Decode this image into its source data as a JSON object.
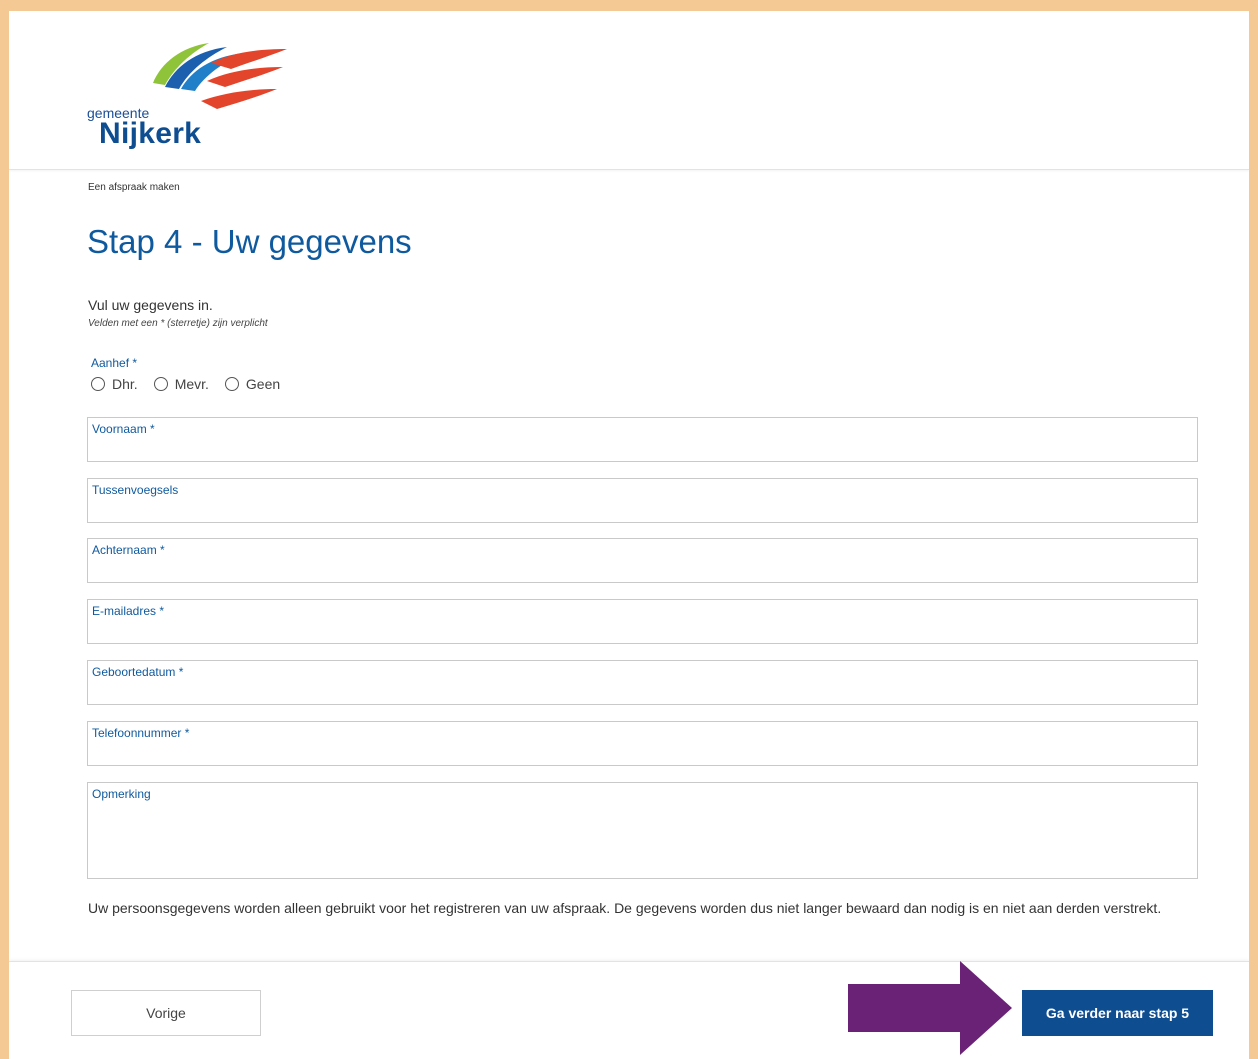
{
  "brand": {
    "small": "gemeente",
    "name": "Nijkerk",
    "colors": {
      "green": "#8fc43a",
      "blue": "#0f4d91",
      "red": "#e2452b",
      "accent_arrow": "#6a2277"
    }
  },
  "breadcrumb": "Een afspraak maken",
  "page_title": "Stap 4 - Uw gegevens",
  "intro": "Vul uw gegevens in.",
  "intro_note": "Velden met een * (sterretje) zijn verplicht",
  "salutation": {
    "label": "Aanhef *",
    "options": [
      "Dhr.",
      "Mevr.",
      "Geen"
    ]
  },
  "fields": {
    "first_name": {
      "label": "Voornaam *",
      "value": ""
    },
    "infix": {
      "label": "Tussenvoegsels",
      "value": ""
    },
    "last_name": {
      "label": "Achternaam *",
      "value": ""
    },
    "email": {
      "label": "E-mailadres *",
      "value": ""
    },
    "birthdate": {
      "label": "Geboortedatum *",
      "value": ""
    },
    "phone": {
      "label": "Telefoonnummer *",
      "value": ""
    },
    "remark": {
      "label": "Opmerking",
      "value": ""
    }
  },
  "privacy_text": "Uw persoonsgegevens worden alleen gebruikt voor het registreren van uw afspraak. De gegevens worden dus niet langer bewaard dan nodig is en niet aan derden verstrekt.",
  "footer": {
    "prev_label": "Vorige",
    "next_label": "Ga verder naar stap 5"
  }
}
